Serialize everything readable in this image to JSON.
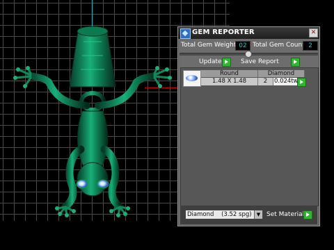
{
  "panel": {
    "title": "GEM REPORTER",
    "close_glyph": "✕",
    "total_weight_label": "Total Gem Weight",
    "total_weight_value": "02",
    "total_count_label": "Total Gem Count",
    "total_count_value": "2",
    "update_label": "Update",
    "save_report_label": "Save Report",
    "table": {
      "headers": [
        "Round",
        "Diamond"
      ],
      "rows": [
        {
          "size": "1.48 X 1.48",
          "count": "2",
          "weight": "0.024tw"
        }
      ]
    },
    "material_select": {
      "name": "Diamond",
      "spg": "(3.52 spg)"
    },
    "set_material_label": "Set Material"
  },
  "icons": {
    "title": "gem-reporter-icon",
    "close": "close-icon",
    "play": "play-icon",
    "gem": "gem-thumbnail-icon",
    "dropdown": "dropdown-arrow-icon"
  },
  "colors": {
    "frog": "#0a8a5a",
    "viewport_bg": "#000000",
    "grid": "#4a4a4a",
    "value_text": "#13d0d0",
    "accent_green": "#2fb82f"
  }
}
